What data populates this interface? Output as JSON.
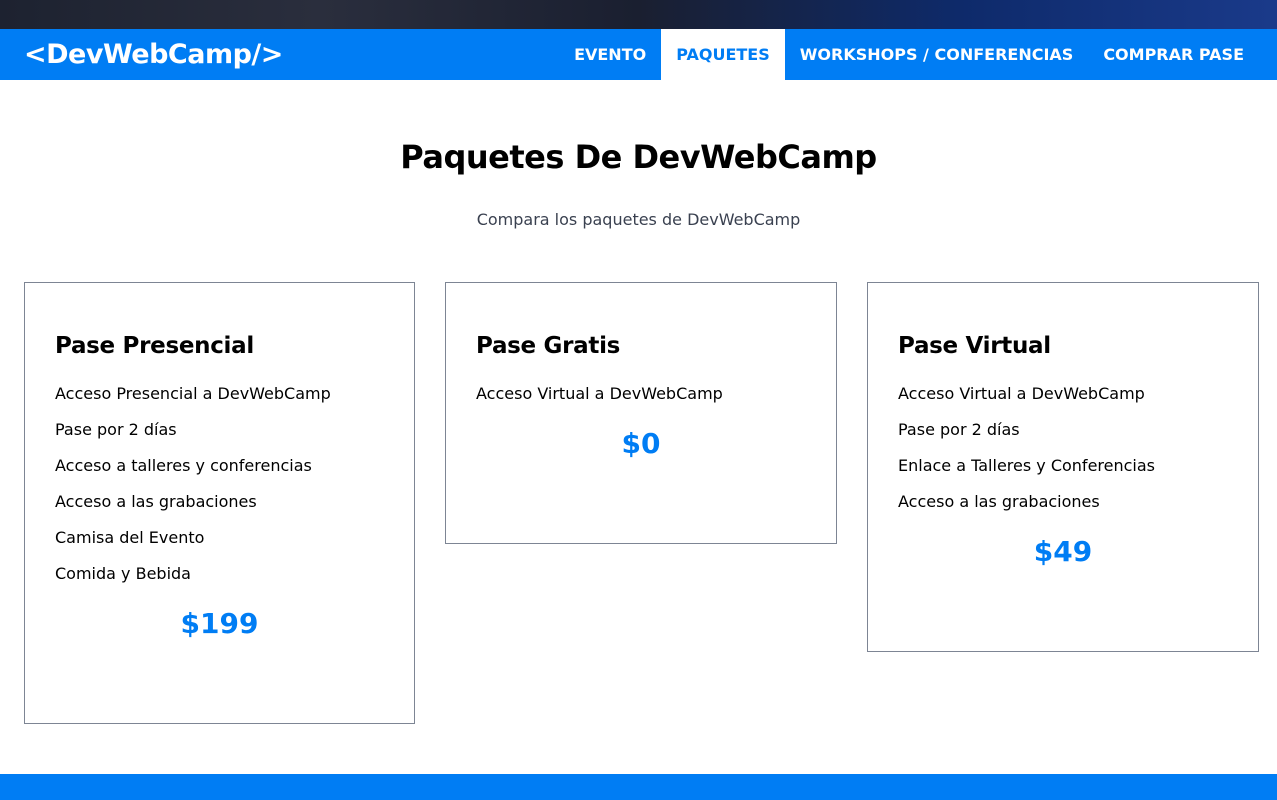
{
  "header": {
    "logo": "<DevWebCamp/>",
    "nav": [
      {
        "label": "EVENTO",
        "active": false
      },
      {
        "label": "PAQUETES",
        "active": true
      },
      {
        "label": "WORKSHOPS / CONFERENCIAS",
        "active": false
      },
      {
        "label": "COMPRAR PASE",
        "active": false
      }
    ]
  },
  "main": {
    "title": "Paquetes De DevWebCamp",
    "subtitle": "Compara los paquetes de DevWebCamp",
    "packages": [
      {
        "name": "Pase Presencial",
        "features": [
          "Acceso Presencial a DevWebCamp",
          "Pase por 2 días",
          "Acceso a talleres y conferencias",
          "Acceso a las grabaciones",
          "Camisa del Evento",
          "Comida y Bebida"
        ],
        "price": "$199"
      },
      {
        "name": "Pase Gratis",
        "features": [
          "Acceso Virtual a DevWebCamp"
        ],
        "price": "$0"
      },
      {
        "name": "Pase Virtual",
        "features": [
          "Acceso Virtual a DevWebCamp",
          "Pase por 2 días",
          "Enlace a Talleres y Conferencias",
          "Acceso a las grabaciones"
        ],
        "price": "$49"
      }
    ]
  },
  "colors": {
    "brand": "#007df4",
    "border": "#7d8594"
  }
}
